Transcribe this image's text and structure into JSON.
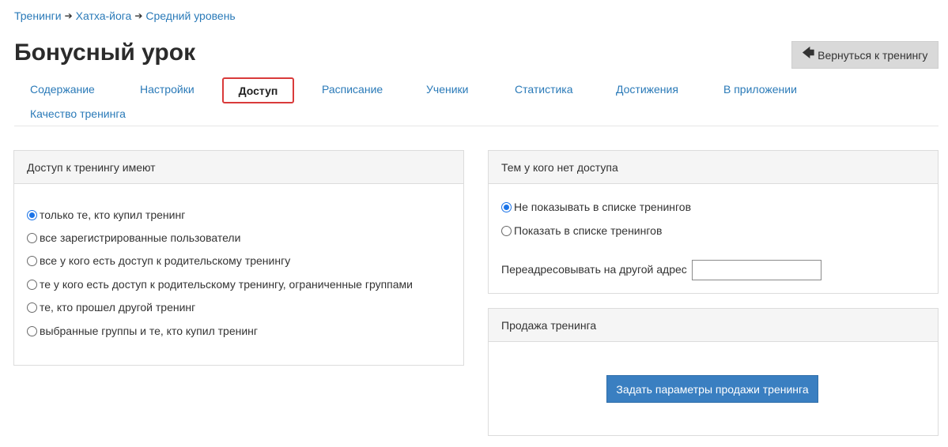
{
  "breadcrumb": {
    "items": [
      "Тренинги",
      "Хатха-йога",
      "Средний уровень"
    ],
    "separator": "➔"
  },
  "page": {
    "title": "Бонусный урок"
  },
  "back_button": {
    "icon": "arrow-left-icon",
    "label": "Вернуться к тренингу"
  },
  "tabs": [
    {
      "label": "Содержание",
      "active": false
    },
    {
      "label": "Настройки",
      "active": false
    },
    {
      "label": "Доступ",
      "active": true
    },
    {
      "label": "Расписание",
      "active": false
    },
    {
      "label": "Ученики",
      "active": false
    },
    {
      "label": "Статистика",
      "active": false
    },
    {
      "label": "Достижения",
      "active": false
    },
    {
      "label": "В приложении",
      "active": false
    },
    {
      "label": "Качество тренинга",
      "active": false
    }
  ],
  "access_panel": {
    "title": "Доступ к тренингу имеют",
    "options": [
      {
        "label": "только те, кто купил тренинг",
        "checked": true
      },
      {
        "label": "все зарегистрированные пользователи",
        "checked": false
      },
      {
        "label": "все у кого есть доступ к родительскому тренингу",
        "checked": false
      },
      {
        "label": "те у кого есть доступ к родительскому тренингу, ограниченные группами",
        "checked": false
      },
      {
        "label": "те, кто прошел другой тренинг",
        "checked": false
      },
      {
        "label": "выбранные группы и те, кто купил тренинг",
        "checked": false
      }
    ]
  },
  "no_access_panel": {
    "title": "Тем у кого нет доступа",
    "options": [
      {
        "label": "Не показывать в списке тренингов",
        "checked": true
      },
      {
        "label": "Показать в списке тренингов",
        "checked": false
      }
    ],
    "redirect_label": "Переадресовывать на другой адрес",
    "redirect_value": ""
  },
  "sale_panel": {
    "title": "Продажа тренинга",
    "button_label": "Задать параметры продажи тренинга"
  },
  "colors": {
    "link": "#2a7ab8",
    "active_tab_border": "#d93a3a",
    "primary_button": "#3a7fc1",
    "radio_checked": "#1a73e8"
  }
}
